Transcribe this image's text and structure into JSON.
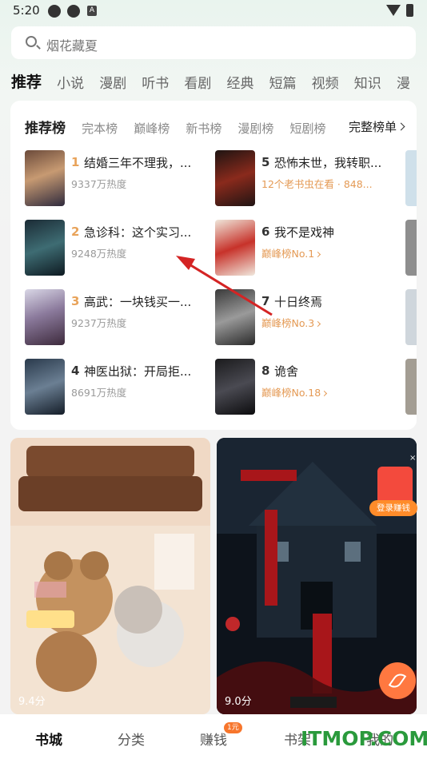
{
  "status_bar": {
    "time": "5:20",
    "icon_label": "A"
  },
  "search": {
    "placeholder": "烟花藏夏"
  },
  "categories": [
    "推荐",
    "小说",
    "漫剧",
    "听书",
    "看剧",
    "经典",
    "短篇",
    "视频",
    "知识",
    "漫"
  ],
  "ranking": {
    "tabs": [
      "推荐榜",
      "完本榜",
      "巅峰榜",
      "新书榜",
      "漫剧榜",
      "短剧榜"
    ],
    "full_list_label": "完整榜单",
    "books": [
      {
        "rank": "1",
        "title": "结婚三年不理我，...",
        "sub": "9337万热度",
        "rank_color": "#e8a35a"
      },
      {
        "rank": "2",
        "title": "急诊科：这个实习...",
        "sub": "9248万热度",
        "rank_color": "#e8a35a"
      },
      {
        "rank": "3",
        "title": "高武：一块钱买一...",
        "sub": "9237万热度",
        "rank_color": "#e8a35a"
      },
      {
        "rank": "4",
        "title": "神医出狱：开局拒...",
        "sub": "8691万热度",
        "rank_color": "#333333"
      },
      {
        "rank": "5",
        "title": "恐怖末世，我转职...",
        "sub": "12个老书虫在看 · 848...",
        "rank_color": "#333333"
      },
      {
        "rank": "6",
        "title": "我不是戏神",
        "sub": "巅峰榜No.1",
        "rank_color": "#333333"
      },
      {
        "rank": "7",
        "title": "十日终焉",
        "sub": "巅峰榜No.3",
        "rank_color": "#333333"
      },
      {
        "rank": "8",
        "title": "诡舍",
        "sub": "巅峰榜No.18",
        "rank_color": "#333333"
      }
    ]
  },
  "promos": {
    "left": {
      "score": "9.4分"
    },
    "right": {
      "score": "9.0分"
    }
  },
  "reward": {
    "label": "登录赚钱",
    "close": "×"
  },
  "bottom_nav": {
    "items": [
      "书城",
      "分类",
      "赚钱",
      "书架",
      "我的"
    ],
    "badge": "1元"
  },
  "watermark": "ITMOP.COM",
  "colors": {
    "accent": "#ff7840",
    "rank_top": "#e8a35a",
    "sub_orange": "#e49a55"
  }
}
